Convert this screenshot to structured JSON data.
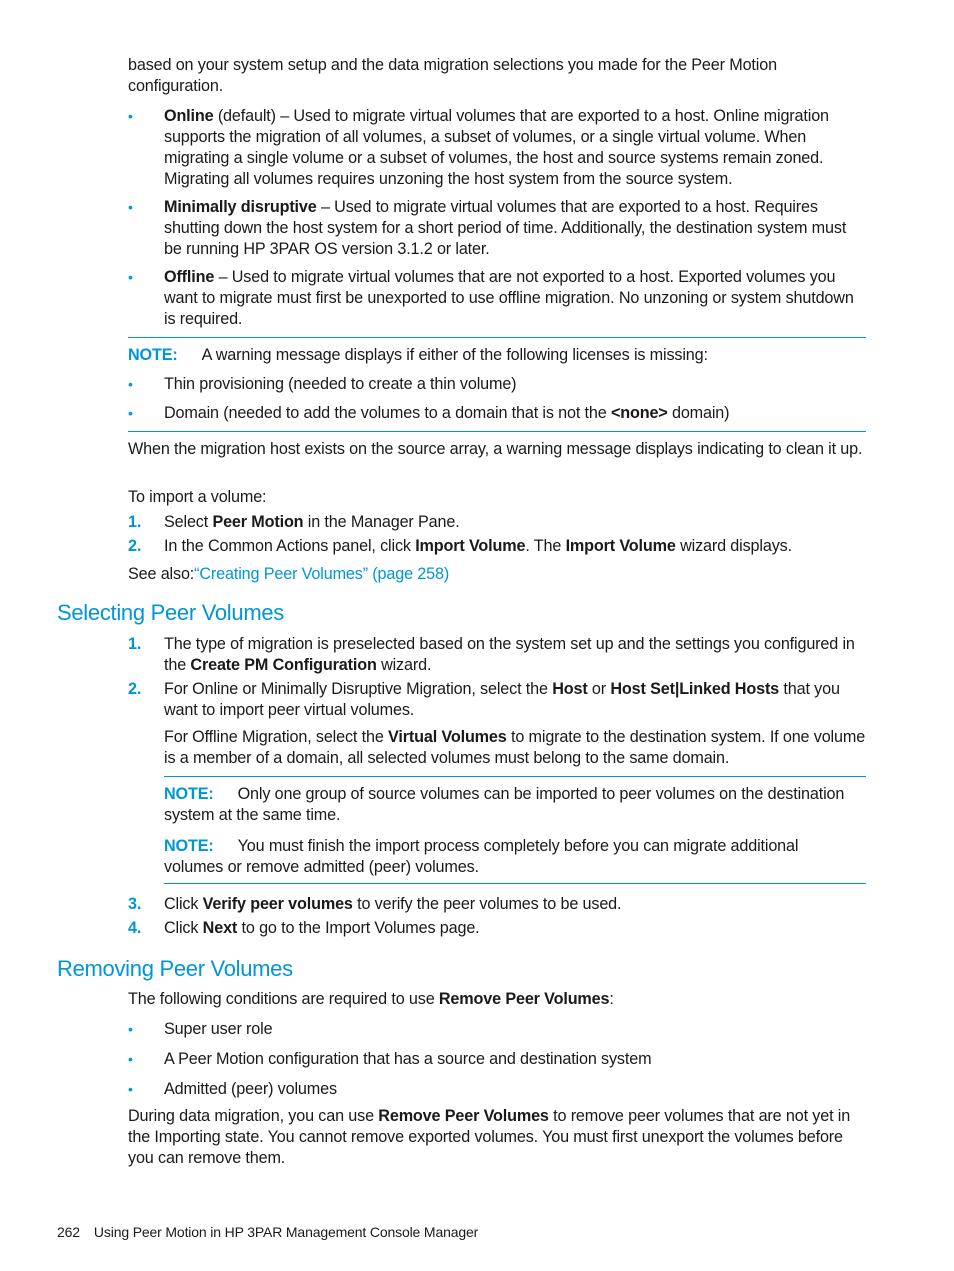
{
  "intro": {
    "text": "based on your system setup and the data migration selections you made for the Peer Motion configuration."
  },
  "migration_types": [
    {
      "term": "Online",
      "rest": " (default) – Used to migrate virtual volumes that are exported to a host. Online migration supports the migration of all volumes, a subset of volumes, or a single virtual volume. When migrating a single volume or a subset of volumes, the host and source systems remain zoned. Migrating all volumes requires unzoning the host system from the source system."
    },
    {
      "term": "Minimally disruptive",
      "rest": " – Used to migrate virtual volumes that are exported to a host. Requires shutting down the host system for a short period of time. Additionally, the destination system must be running HP 3PAR OS version 3.1.2 or later."
    },
    {
      "term": "Offline",
      "rest": " – Used to migrate virtual volumes that are not exported to a host. Exported volumes you want to migrate must first be unexported to use offline migration. No unzoning or system shutdown is required."
    }
  ],
  "note1": {
    "label": "NOTE:",
    "text": "A warning message displays if either of the following licenses is missing:",
    "items": [
      {
        "pre": "Thin provisioning (needed to create a thin volume)",
        "bold": "",
        "post": ""
      },
      {
        "pre": "Domain (needed to add the volumes to a domain that is not the ",
        "bold": "<none>",
        "post": " domain)"
      }
    ]
  },
  "warning_text": "When the migration host exists on the source array, a warning message displays indicating to clean it up.",
  "import_intro": "To import a volume:",
  "import_steps": [
    {
      "num": "1.",
      "parts": [
        {
          "t": "Select "
        },
        {
          "b": "Peer Motion"
        },
        {
          "t": " in the Manager Pane."
        }
      ]
    },
    {
      "num": "2.",
      "parts": [
        {
          "t": "In the Common Actions panel, click "
        },
        {
          "b": "Import Volume"
        },
        {
          "t": ". The "
        },
        {
          "b": "Import Volume"
        },
        {
          "t": " wizard displays."
        }
      ]
    }
  ],
  "see_also": {
    "label": "See also:",
    "link": "“Creating Peer Volumes” (page 258)"
  },
  "section_selecting": {
    "title": "Selecting Peer Volumes",
    "steps": [
      {
        "num": "1.",
        "parts": [
          {
            "t": "The type of migration is preselected based on the system set up and the settings you configured in the "
          },
          {
            "b": "Create PM Configuration"
          },
          {
            "t": " wizard."
          }
        ]
      },
      {
        "num": "2.",
        "parts": [
          {
            "t": "For Online or Minimally Disruptive Migration, select the "
          },
          {
            "b": "Host"
          },
          {
            "t": " or "
          },
          {
            "b": "Host Set|Linked Hosts"
          },
          {
            "t": " that you want to import peer virtual volumes."
          }
        ]
      }
    ],
    "offline_para": [
      {
        "t": "For Offline Migration, select the "
      },
      {
        "b": "Virtual Volumes"
      },
      {
        "t": " to migrate to the destination system. If one volume is a member of a domain, all selected volumes must belong to the same domain."
      }
    ],
    "notes": [
      {
        "label": "NOTE:",
        "text": "Only one group of source volumes can be imported to peer volumes on the destination system at the same time."
      },
      {
        "label": "NOTE:",
        "text": "You must finish the import process completely before you can migrate additional volumes or remove admitted (peer) volumes."
      }
    ],
    "steps_after": [
      {
        "num": "3.",
        "parts": [
          {
            "t": "Click "
          },
          {
            "b": "Verify peer volumes"
          },
          {
            "t": " to verify the peer volumes to be used."
          }
        ]
      },
      {
        "num": "4.",
        "parts": [
          {
            "t": "Click "
          },
          {
            "b": "Next"
          },
          {
            "t": " to go to the Import Volumes page."
          }
        ]
      }
    ]
  },
  "section_removing": {
    "title": "Removing Peer Volumes",
    "intro": [
      {
        "t": "The following conditions are required to use "
      },
      {
        "b": "Remove Peer Volumes"
      },
      {
        "t": ":"
      }
    ],
    "conditions": [
      "Super user role",
      "A Peer Motion configuration that has a source and destination system",
      "Admitted (peer) volumes"
    ],
    "para": [
      {
        "t": "During data migration, you can use "
      },
      {
        "b": "Remove Peer Volumes"
      },
      {
        "t": " to remove peer volumes that are not yet in the Importing state. You cannot remove exported volumes. You must first unexport the volumes before you can remove them."
      }
    ]
  },
  "footer": {
    "page_number": "262",
    "running_title": "Using Peer Motion in HP 3PAR Management Console Manager"
  },
  "colors": {
    "accent": "#0096d6",
    "text": "#1a1a1a"
  },
  "bullet_glyph": "•"
}
